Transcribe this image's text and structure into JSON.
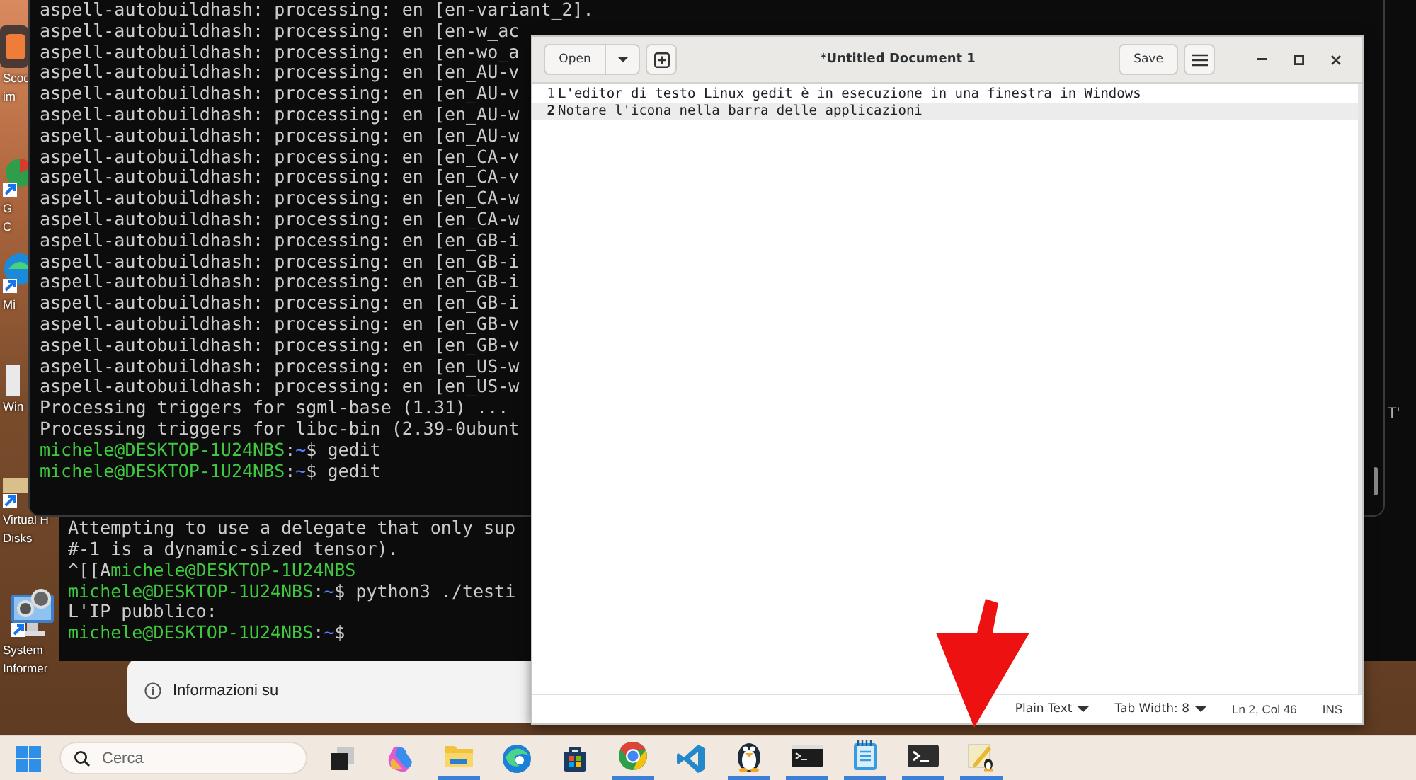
{
  "desktop_icons": [
    {
      "kind": "orange-tile",
      "labels": [
        "Scoo",
        "im"
      ]
    },
    {
      "kind": "round-browser",
      "labels": [
        "G",
        "C"
      ]
    },
    {
      "kind": "blue-wave",
      "labels": [
        "Mi"
      ]
    },
    {
      "kind": "white-sheet",
      "labels": [
        "Win"
      ]
    },
    {
      "kind": "disk",
      "labels": [
        "Virtual H",
        "Disks"
      ]
    },
    {
      "kind": "monitor-gears",
      "labels": [
        "System",
        "Informer"
      ]
    }
  ],
  "back_terminal": {
    "edge_text": "T'",
    "lines": [
      {
        "kind": "output",
        "text": "Attempting to use a delegate that only sup"
      },
      {
        "kind": "output",
        "text": "#-1 is a dynamic-sized tensor)."
      },
      {
        "kind": "prompt",
        "prefix": "^[[A",
        "host": "michele@DESKTOP-1U24NBS"
      },
      {
        "kind": "prompt",
        "host": "michele@DESKTOP-1U24NBS",
        "sep": ":",
        "path": "~",
        "command": "$ python3 ./testi"
      },
      {
        "kind": "output",
        "text": "L'IP pubblico:"
      },
      {
        "kind": "prompt",
        "host": "michele@DESKTOP-1U24NBS",
        "sep": ":",
        "path": "~",
        "command": "$"
      }
    ]
  },
  "terminal": {
    "lines": [
      {
        "kind": "output",
        "text": "aspell-autobuildhash: processing: en [en-variant_2]."
      },
      {
        "kind": "output",
        "text": "aspell-autobuildhash: processing: en [en-w_ac"
      },
      {
        "kind": "output",
        "text": "aspell-autobuildhash: processing: en [en-wo_a"
      },
      {
        "kind": "output",
        "text": "aspell-autobuildhash: processing: en [en_AU-v"
      },
      {
        "kind": "output",
        "text": "aspell-autobuildhash: processing: en [en_AU-v"
      },
      {
        "kind": "output",
        "text": "aspell-autobuildhash: processing: en [en_AU-w"
      },
      {
        "kind": "output",
        "text": "aspell-autobuildhash: processing: en [en_AU-w"
      },
      {
        "kind": "output",
        "text": "aspell-autobuildhash: processing: en [en_CA-v"
      },
      {
        "kind": "output",
        "text": "aspell-autobuildhash: processing: en [en_CA-v"
      },
      {
        "kind": "output",
        "text": "aspell-autobuildhash: processing: en [en_CA-w"
      },
      {
        "kind": "output",
        "text": "aspell-autobuildhash: processing: en [en_CA-w"
      },
      {
        "kind": "output",
        "text": "aspell-autobuildhash: processing: en [en_GB-i"
      },
      {
        "kind": "output",
        "text": "aspell-autobuildhash: processing: en [en_GB-i"
      },
      {
        "kind": "output",
        "text": "aspell-autobuildhash: processing: en [en_GB-i"
      },
      {
        "kind": "output",
        "text": "aspell-autobuildhash: processing: en [en_GB-i"
      },
      {
        "kind": "output",
        "text": "aspell-autobuildhash: processing: en [en_GB-v"
      },
      {
        "kind": "output",
        "text": "aspell-autobuildhash: processing: en [en_GB-v"
      },
      {
        "kind": "output",
        "text": "aspell-autobuildhash: processing: en [en_US-w"
      },
      {
        "kind": "output",
        "text": "aspell-autobuildhash: processing: en [en_US-w"
      },
      {
        "kind": "output",
        "text": "Processing triggers for sgml-base (1.31) ..."
      },
      {
        "kind": "output",
        "text": "Processing triggers for libc-bin (2.39-0ubunt"
      },
      {
        "kind": "prompt",
        "host": "michele@DESKTOP-1U24NBS",
        "sep": ":",
        "path": "~",
        "command": "$ gedit"
      },
      {
        "kind": "prompt",
        "host": "michele@DESKTOP-1U24NBS",
        "sep": ":",
        "path": "~",
        "command": "$ gedit"
      }
    ]
  },
  "info_window": {
    "label": "Informazioni su"
  },
  "gedit": {
    "open_button": "Open",
    "title": "*Untitled Document 1",
    "save_button": "Save",
    "lines": [
      {
        "number": "1",
        "text": "L'editor di testo Linux gedit è in esecuzione in una finestra in Windows",
        "current": false
      },
      {
        "number": "2",
        "text": "Notare l'icona nella barra delle applicazioni",
        "current": true
      }
    ],
    "status_bar": {
      "language": "Plain Text",
      "tab_width": "Tab Width: 8",
      "position": "Ln 2, Col 46",
      "mode": "INS"
    }
  },
  "taskbar": {
    "search_placeholder": "Cerca",
    "apps": [
      {
        "kind": "task-view",
        "running": false
      },
      {
        "kind": "sparkle",
        "running": false
      },
      {
        "kind": "folder",
        "running": true
      },
      {
        "kind": "wave-browser",
        "running": false
      },
      {
        "kind": "store",
        "running": false
      },
      {
        "kind": "round-browser",
        "running": true
      },
      {
        "kind": "code",
        "running": false
      },
      {
        "kind": "penguin",
        "running": true
      },
      {
        "kind": "console",
        "running": true
      },
      {
        "kind": "notepad",
        "running": true
      },
      {
        "kind": "terminal",
        "running": true
      },
      {
        "kind": "pencil",
        "running": true
      }
    ]
  }
}
